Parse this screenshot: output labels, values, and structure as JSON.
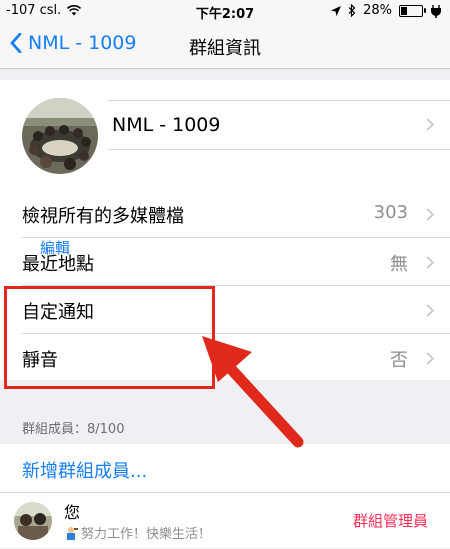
{
  "status": {
    "signal": "-107 csl.",
    "time": "下午2:07",
    "battery": "28%",
    "battery_level": 0.28
  },
  "nav": {
    "back_label": "NML - 1009",
    "title": "群組資訊"
  },
  "group": {
    "name": "NML - 1009",
    "edit_label": "編輯"
  },
  "rows": [
    {
      "label": "檢視所有的多媒體檔",
      "value": "303"
    },
    {
      "label": "最近地點",
      "value": "無"
    },
    {
      "label": "自定通知",
      "value": ""
    },
    {
      "label": "靜音",
      "value": "否"
    }
  ],
  "members": {
    "header": "群組成員：8/100",
    "add_label": "新增群組成員...",
    "list": [
      {
        "name": "您",
        "status": "努力工作！快樂生活！",
        "role": "群組管理員"
      }
    ]
  },
  "colors": {
    "accent": "#157efb",
    "admin": "#ff2d55",
    "annotation": "#e0291a"
  },
  "icons": [
    "wifi-icon",
    "location-arrow-icon",
    "bluetooth-icon",
    "battery-icon",
    "charging-icon",
    "back-chevron-icon",
    "chevron-right-icon",
    "arrow-annotation"
  ]
}
